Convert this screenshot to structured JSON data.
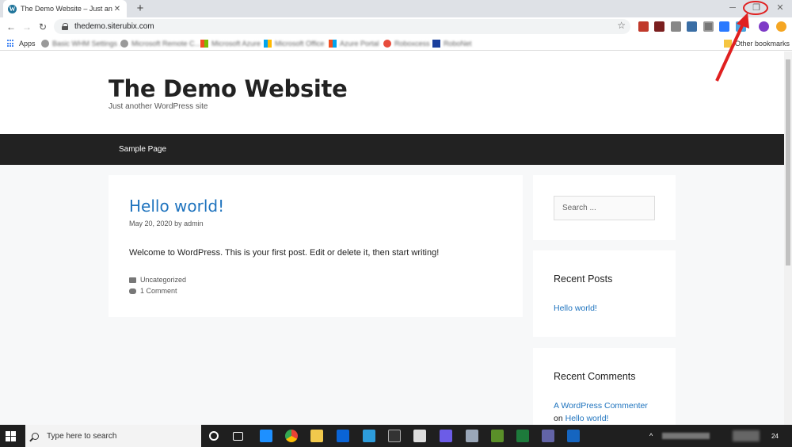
{
  "browser": {
    "tab_title": "The Demo Website – Just anothe",
    "tab_close": "✕",
    "new_tab": "+",
    "url": "thedemo.siterubix.com",
    "window_min": "─",
    "window_restore": "❐",
    "window_close": "✕",
    "star": "☆"
  },
  "bookmarks": {
    "apps_label": "Apps",
    "items": [
      "Basic WHM Settings ...",
      "Microsoft Remote C...",
      "Microsoft Azure",
      "Microsoft Office",
      "Azure Portal",
      "Roboxcess",
      "RoboNet"
    ],
    "other": "Other bookmarks"
  },
  "site": {
    "title": "The Demo Website",
    "tagline": "Just another WordPress site",
    "nav": [
      "Sample Page"
    ]
  },
  "post": {
    "title": "Hello world!",
    "date": "May 20, 2020",
    "by": "by",
    "author": "admin",
    "body": "Welcome to WordPress. This is your first post. Edit or delete it, then start writing!",
    "category": "Uncategorized",
    "comments": "1 Comment"
  },
  "sidebar": {
    "search_placeholder": "Search ...",
    "recent_posts_title": "Recent Posts",
    "recent_posts": [
      "Hello world!"
    ],
    "recent_comments_title": "Recent Comments",
    "comment_author": "A WordPress Commenter",
    "comment_on": "on",
    "comment_post": "Hello world!"
  },
  "taskbar": {
    "search_placeholder": "Type here to search",
    "badge": "24"
  },
  "colors": {
    "link": "#1e73be",
    "nav_bg": "#222222",
    "annotation": "#e02020"
  }
}
